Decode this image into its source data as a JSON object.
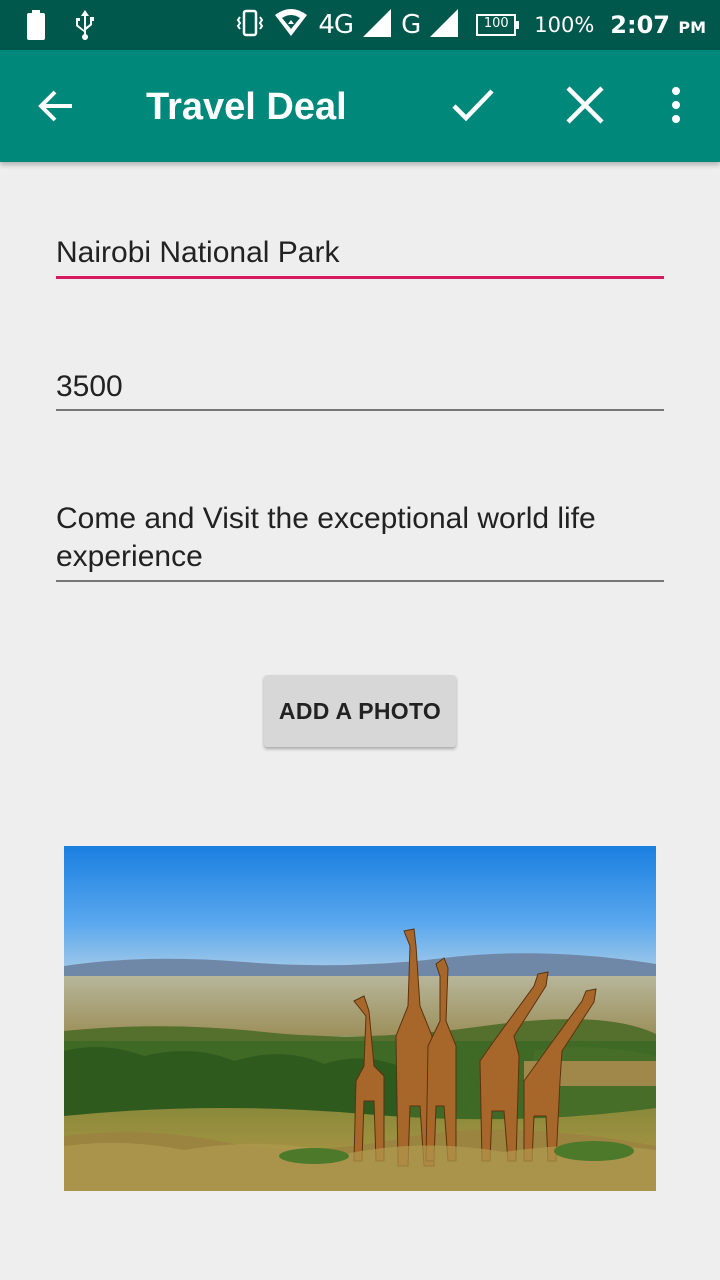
{
  "status_bar": {
    "network_4g": "4G",
    "network_g": "G",
    "battery_box": "100",
    "battery_percent": "100%",
    "time": "2:07",
    "ampm": "PM",
    "icons": [
      "battery-icon",
      "usb-icon",
      "vibrate-icon",
      "wifi-icon",
      "signal-icon"
    ]
  },
  "app_bar": {
    "title": "Travel Deal",
    "color": "#00897b",
    "status_color": "#00574b",
    "icons": [
      "back-arrow-icon",
      "check-icon",
      "close-icon",
      "overflow-menu-icon"
    ]
  },
  "form": {
    "title_value": "Nairobi National Park",
    "price_value": "3500",
    "description_value": "Come and Visit the exceptional world life experience",
    "accent_color": "#d81b60"
  },
  "actions": {
    "add_photo_label": "ADD A PHOTO"
  },
  "photo": {
    "subject": "giraffes on savanna"
  }
}
